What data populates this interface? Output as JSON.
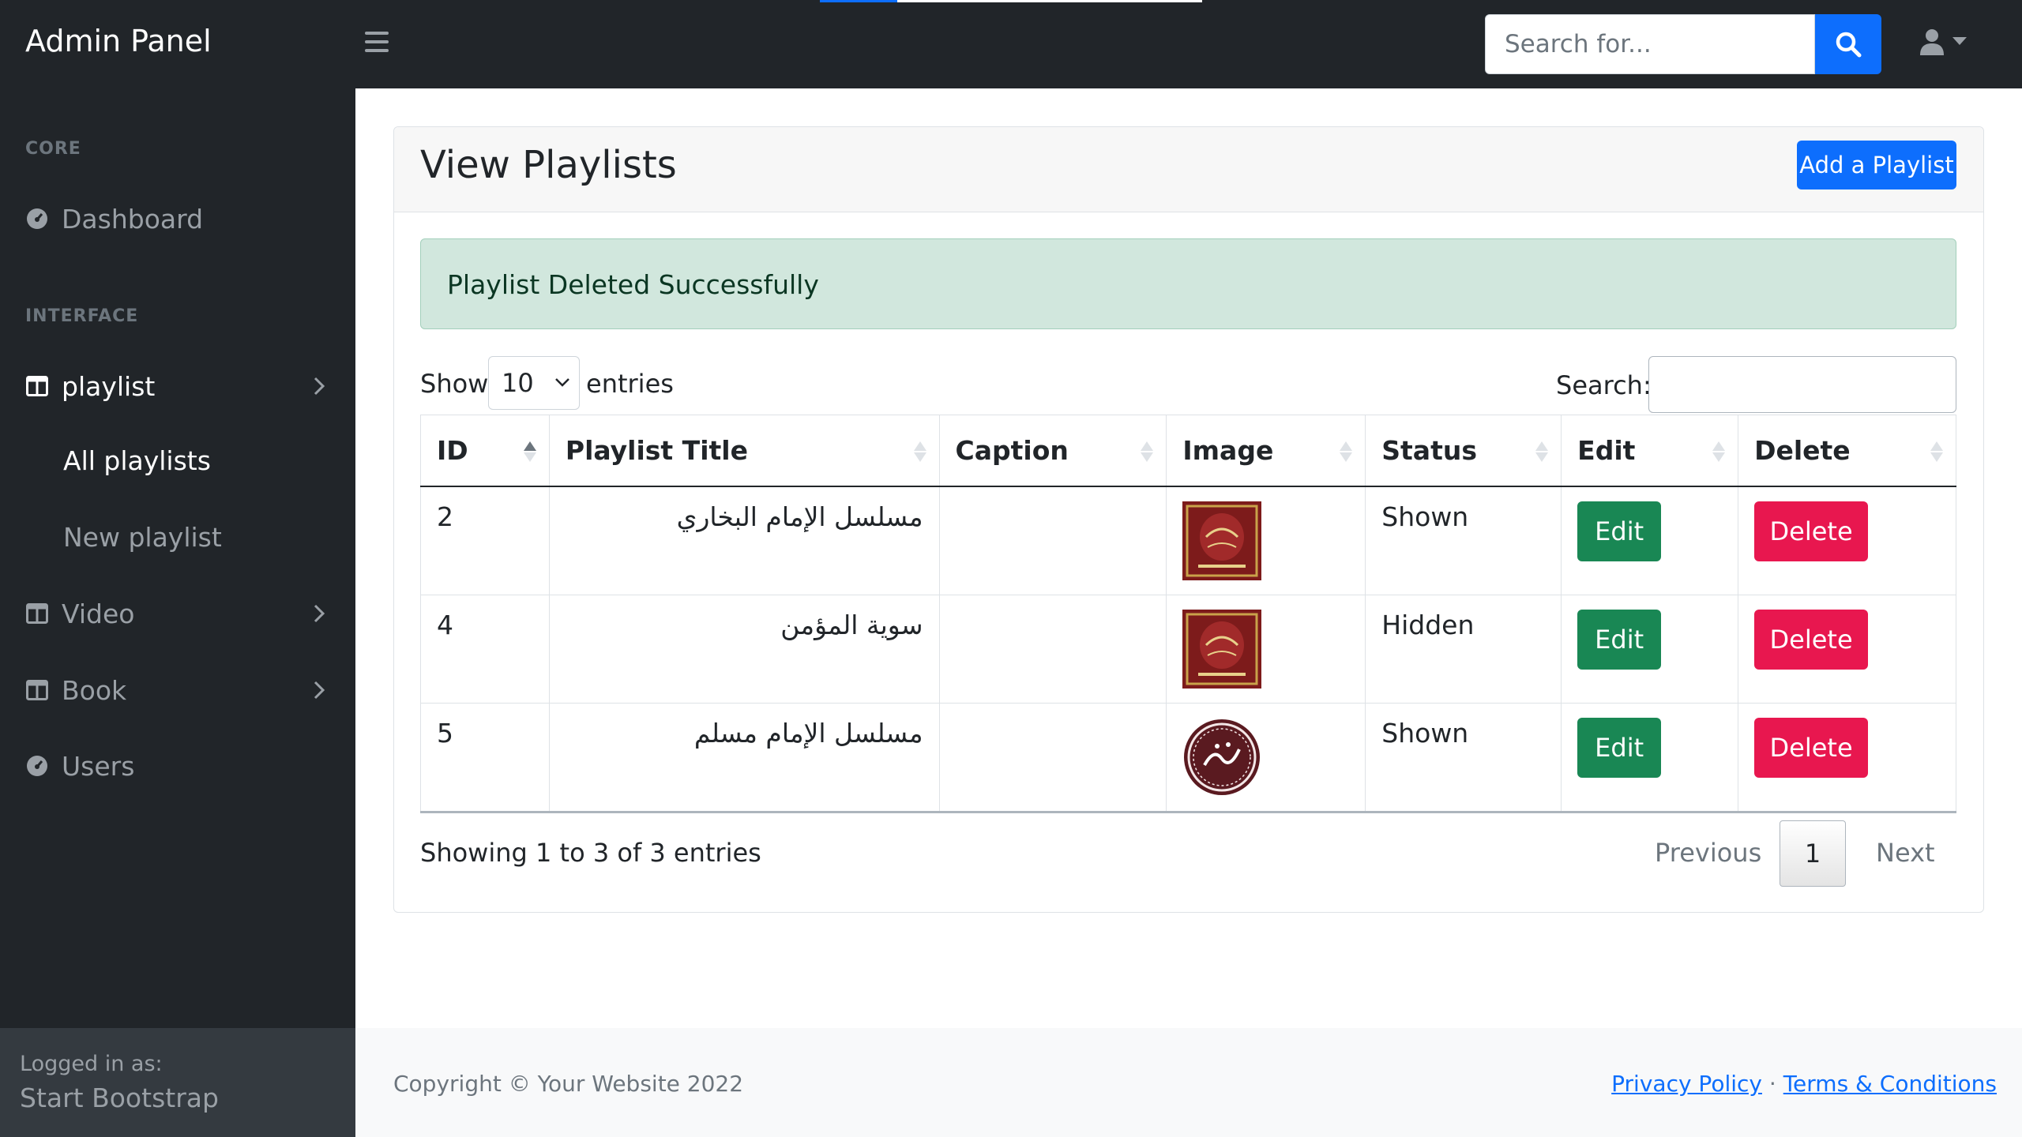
{
  "app": {
    "brand": "Admin Panel"
  },
  "topbar": {
    "search": {
      "placeholder": "Search for..."
    },
    "icons": [
      "menu-icon",
      "search-icon",
      "user-icon",
      "caret-down-icon"
    ]
  },
  "sidebar": {
    "sections": [
      {
        "heading": "CORE"
      },
      {
        "heading": "INTERFACE"
      }
    ],
    "items": {
      "dashboard": "Dashboard",
      "playlist": "playlist",
      "all_playlists": "All playlists",
      "new_playlist": "New playlist",
      "video": "Video",
      "book": "Book",
      "users": "Users"
    },
    "footer": {
      "logged_in_as": "Logged in as:",
      "user": "Start Bootstrap"
    }
  },
  "main": {
    "title": "View Playlists",
    "add_button": "Add a Playlist",
    "alert": "Playlist Deleted Successfully",
    "table_controls": {
      "show": "Show",
      "page_length": "10",
      "entries": "entries",
      "search_label": "Search:"
    },
    "columns": [
      "ID",
      "Playlist Title",
      "Caption",
      "Image",
      "Status",
      "Edit",
      "Delete"
    ],
    "rows": [
      {
        "id": "2",
        "title": "مسلسل الإمام البخاري",
        "caption": "",
        "status": "Shown",
        "edit": "Edit",
        "delete": "Delete",
        "image": "red-book-cover"
      },
      {
        "id": "4",
        "title": "سوية المؤمن",
        "caption": "",
        "status": "Hidden",
        "edit": "Edit",
        "delete": "Delete",
        "image": "red-book-cover"
      },
      {
        "id": "5",
        "title": "مسلسل الإمام مسلم",
        "caption": "",
        "status": "Shown",
        "edit": "Edit",
        "delete": "Delete",
        "image": "round-calligraphy-seal"
      }
    ],
    "info": "Showing 1 to 3 of 3 entries",
    "pagination": {
      "previous": "Previous",
      "current": "1",
      "next": "Next"
    }
  },
  "footer": {
    "copyright": "Copyright © Your Website 2022",
    "privacy": "Privacy Policy",
    "separator": "·",
    "terms": "Terms & Conditions"
  },
  "colors": {
    "navbar": "#212529",
    "primary": "#0d6efd",
    "success": "#198754",
    "danger": "#e8174f",
    "alert_bg": "#d1e7dd"
  }
}
